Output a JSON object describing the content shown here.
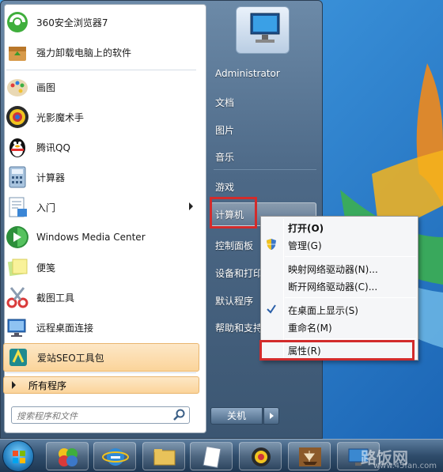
{
  "programs": {
    "pinned": [
      {
        "label": "360安全浏览器7",
        "icon": "360-browser-icon"
      },
      {
        "label": "强力卸载电脑上的软件",
        "icon": "uninstall-box-icon"
      }
    ],
    "recent": [
      {
        "label": "画图",
        "icon": "paint-palette-icon"
      },
      {
        "label": "光影魔术手",
        "icon": "aperture-icon"
      },
      {
        "label": "腾讯QQ",
        "icon": "qq-penguin-icon"
      },
      {
        "label": "计算器",
        "icon": "calculator-icon"
      },
      {
        "label": "入门",
        "icon": "getting-started-icon"
      },
      {
        "label": "Windows Media Center",
        "icon": "media-center-icon"
      },
      {
        "label": "便笺",
        "icon": "sticky-notes-icon"
      },
      {
        "label": "截图工具",
        "icon": "scissors-icon"
      },
      {
        "label": "远程桌面连接",
        "icon": "remote-desktop-icon"
      },
      {
        "label": "爱站SEO工具包",
        "icon": "seo-toolkit-icon"
      }
    ],
    "all_programs_label": "所有程序",
    "search_placeholder": "搜索程序和文件"
  },
  "right_pane": {
    "user": "Administrator",
    "items": [
      "文档",
      "图片",
      "音乐",
      "游戏",
      "计算机",
      "控制面板",
      "设备和打印",
      "默认程序",
      "帮助和支持"
    ],
    "shutdown_label": "关机"
  },
  "context_menu": {
    "items": [
      "打开(O)",
      "管理(G)",
      "映射网络驱动器(N)...",
      "断开网络驱动器(C)...",
      "在桌面上显示(S)",
      "重命名(M)",
      "属性(R)"
    ]
  },
  "watermark": {
    "main": "路饭网",
    "sub": "www.45fan.com"
  },
  "colors": {
    "highlight": "#fbd49a",
    "red_box": "#d22b2b",
    "menu_bg": "#4d6987"
  }
}
